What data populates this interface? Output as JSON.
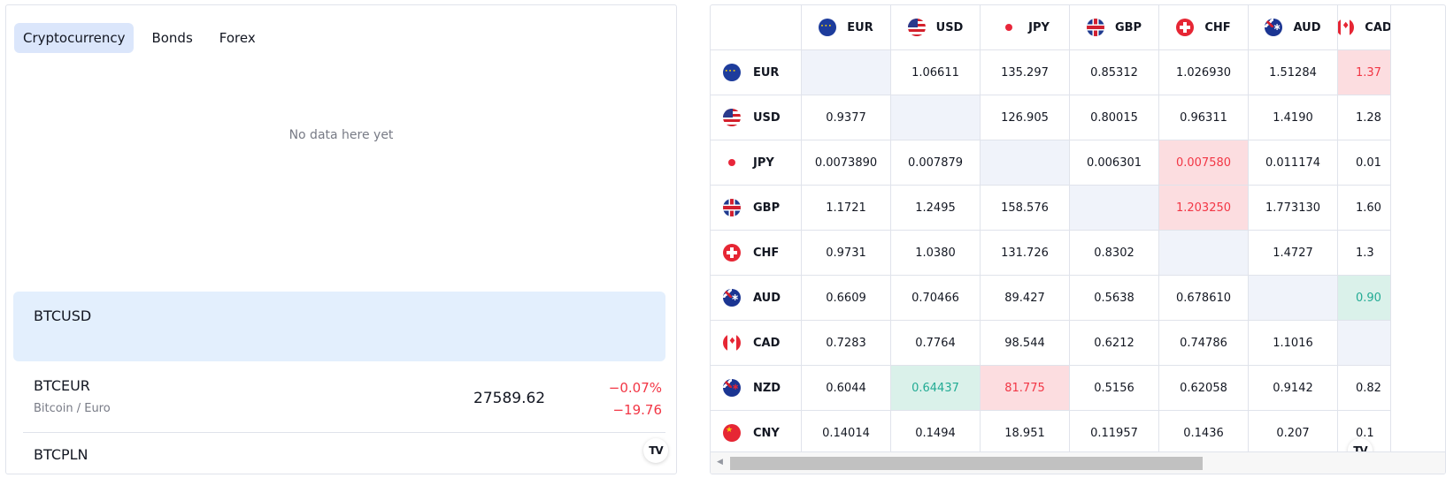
{
  "left_widget": {
    "tabs": [
      {
        "label": "Cryptocurrency",
        "active": true
      },
      {
        "label": "Bonds",
        "active": false
      },
      {
        "label": "Forex",
        "active": false
      }
    ],
    "empty_message": "No data here yet",
    "symbols": [
      {
        "symbol": "BTCUSD",
        "selected": true
      },
      {
        "symbol": "BTCEUR",
        "description": "Bitcoin / Euro",
        "price": "27589.62",
        "change_percent": "−0.07%",
        "change": "−19.76"
      },
      {
        "symbol": "BTCPLN"
      }
    ],
    "logo_icon": "tradingview-logo-icon",
    "logo_text": "TV"
  },
  "cross_rates": {
    "columns": [
      "EUR",
      "USD",
      "JPY",
      "GBP",
      "CHF",
      "AUD",
      "CAD"
    ],
    "column_flags": [
      "eur",
      "usd",
      "jpy",
      "gbp",
      "chf",
      "aud",
      "cad"
    ],
    "rows": [
      {
        "code": "EUR",
        "flag": "eur",
        "values": [
          "",
          "1.06611",
          "135.297",
          "0.85312",
          "1.026930",
          "1.51284",
          "1.37"
        ],
        "states": [
          "diag",
          "",
          "",
          "",
          "",
          "",
          "down"
        ]
      },
      {
        "code": "USD",
        "flag": "usd",
        "values": [
          "0.9377",
          "",
          "126.905",
          "0.80015",
          "0.96311",
          "1.4190",
          "1.28"
        ],
        "states": [
          "",
          "diag",
          "",
          "",
          "",
          "",
          ""
        ]
      },
      {
        "code": "JPY",
        "flag": "jpy",
        "values": [
          "0.0073890",
          "0.007879",
          "",
          "0.006301",
          "0.007580",
          "0.011174",
          "0.01"
        ],
        "states": [
          "",
          "",
          "diag",
          "",
          "down",
          "",
          ""
        ]
      },
      {
        "code": "GBP",
        "flag": "gbp",
        "values": [
          "1.1721",
          "1.2495",
          "158.576",
          "",
          "1.203250",
          "1.773130",
          "1.60"
        ],
        "states": [
          "",
          "",
          "",
          "diag",
          "down",
          "",
          ""
        ]
      },
      {
        "code": "CHF",
        "flag": "chf",
        "values": [
          "0.9731",
          "1.0380",
          "131.726",
          "0.8302",
          "",
          "1.4727",
          "1.3"
        ],
        "states": [
          "",
          "",
          "",
          "",
          "diag",
          "",
          ""
        ]
      },
      {
        "code": "AUD",
        "flag": "aud",
        "values": [
          "0.6609",
          "0.70466",
          "89.427",
          "0.5638",
          "0.678610",
          "",
          "0.90"
        ],
        "states": [
          "",
          "",
          "",
          "",
          "",
          "diag",
          "up"
        ]
      },
      {
        "code": "CAD",
        "flag": "cad",
        "values": [
          "0.7283",
          "0.7764",
          "98.544",
          "0.6212",
          "0.74786",
          "1.1016",
          ""
        ],
        "states": [
          "",
          "",
          "",
          "",
          "",
          "",
          "diag"
        ]
      },
      {
        "code": "NZD",
        "flag": "nzd",
        "values": [
          "0.6044",
          "0.64437",
          "81.775",
          "0.5156",
          "0.62058",
          "0.9142",
          "0.82"
        ],
        "states": [
          "",
          "up",
          "down",
          "",
          "",
          "",
          ""
        ]
      },
      {
        "code": "CNY",
        "flag": "cny",
        "values": [
          "0.14014",
          "0.1494",
          "18.951",
          "0.11957",
          "0.1436",
          "0.207",
          "0.1"
        ],
        "states": [
          "",
          "",
          "",
          "",
          "",
          "",
          ""
        ]
      }
    ],
    "logo_icon": "tradingview-logo-icon",
    "logo_text": "TV",
    "scroll_left_icon": "◀"
  },
  "colors": {
    "positive": "#22ab94",
    "negative": "#f23645",
    "selected_row": "#e3effd",
    "active_tab": "#dbe6fb"
  }
}
